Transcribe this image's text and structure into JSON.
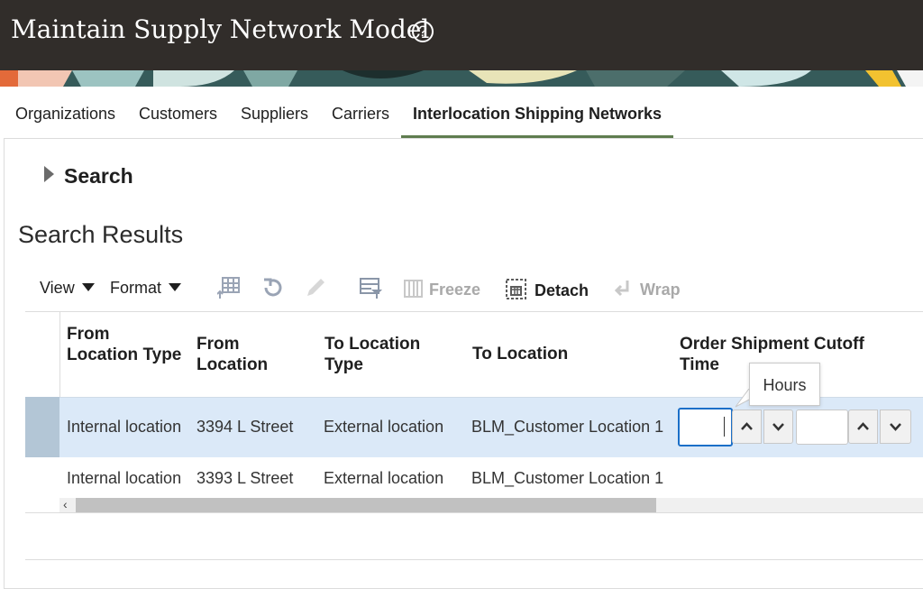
{
  "header": {
    "title": "Maintain Supply Network Model",
    "help_icon": "help-icon",
    "help_glyph": "?"
  },
  "tabs": [
    {
      "label": "Organizations",
      "active": false
    },
    {
      "label": "Customers",
      "active": false
    },
    {
      "label": "Suppliers",
      "active": false
    },
    {
      "label": "Carriers",
      "active": false
    },
    {
      "label": "Interlocation Shipping Networks",
      "active": true
    }
  ],
  "search": {
    "label": "Search"
  },
  "results": {
    "title": "Search Results"
  },
  "toolbar": {
    "view_label": "View",
    "format_label": "Format",
    "freeze_label": "Freeze",
    "detach_label": "Detach",
    "wrap_label": "Wrap"
  },
  "table": {
    "columns": [
      {
        "label": "From Location Type"
      },
      {
        "label": "From Location"
      },
      {
        "label": "To Location Type"
      },
      {
        "label": "To Location"
      },
      {
        "label": "Order Shipment Cutoff Time"
      }
    ],
    "rows": [
      {
        "from_type": "Internal location",
        "from_location": "3394 L Street",
        "to_type": "External location",
        "to_location": "BLM_Customer Location 1",
        "hours": "",
        "minutes": "",
        "selected": true
      },
      {
        "from_type": "Internal location",
        "from_location": "3393 L Street",
        "to_type": "External location",
        "to_location": "BLM_Customer Location 1"
      }
    ]
  },
  "tooltip": {
    "text": "Hours"
  },
  "colors": {
    "header_bg": "#312d2a",
    "tab_accent": "#5f7d4f",
    "selected_row": "#dbe9f8",
    "focus": "#1b6fc8"
  }
}
